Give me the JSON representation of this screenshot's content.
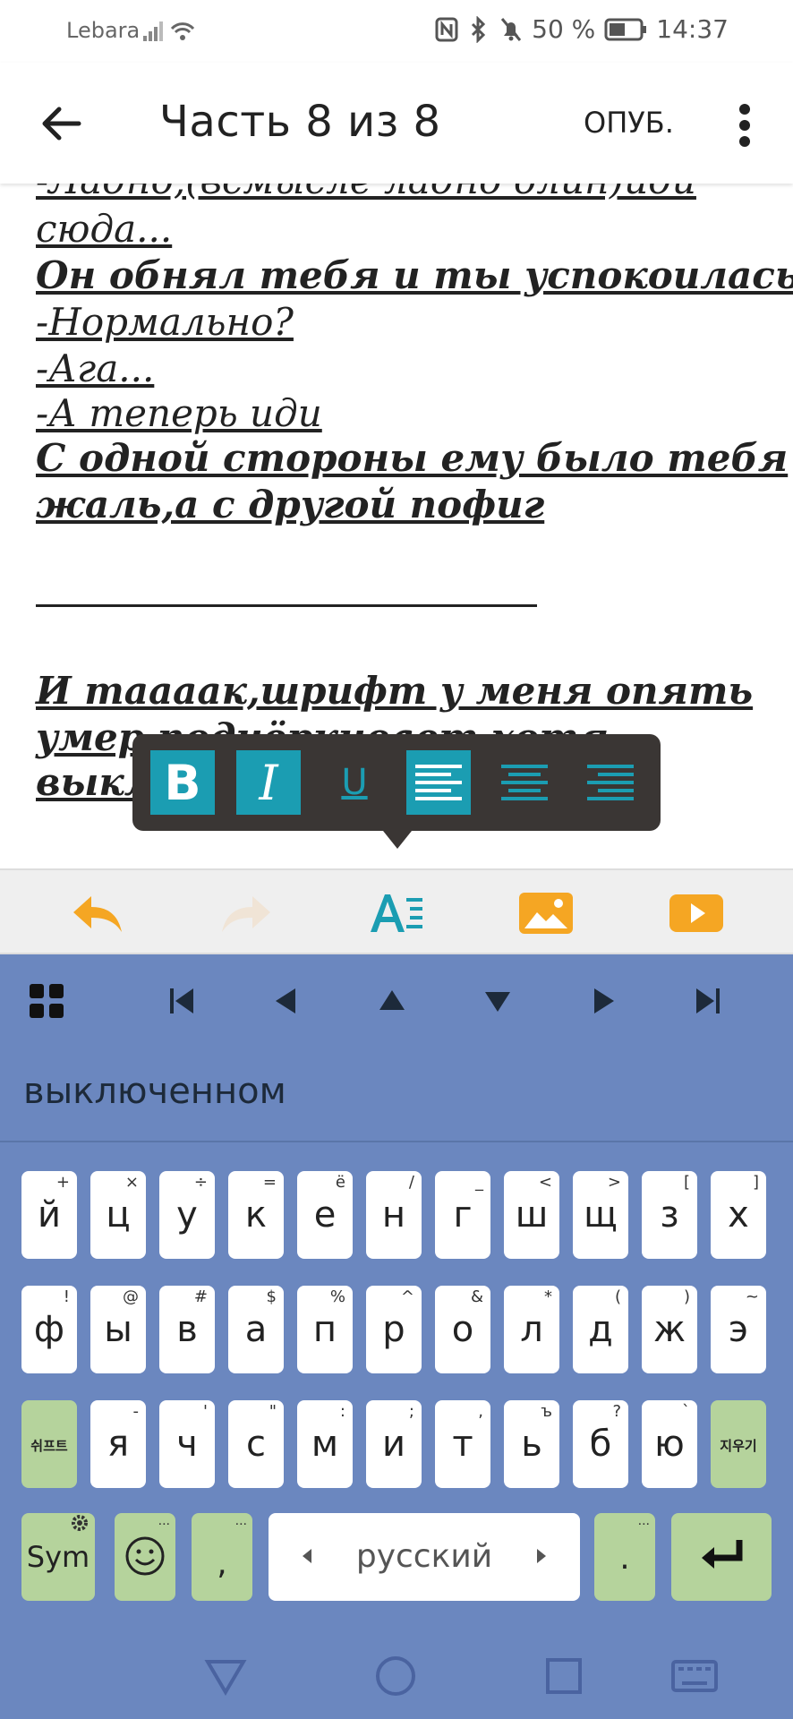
{
  "status_bar": {
    "carrier": "Lebara",
    "battery": "50 %",
    "time": "14:37"
  },
  "app_bar": {
    "title": "Часть 8 из 8",
    "publish_label": "ОПУБ."
  },
  "editor": {
    "lines": [
      "-Ладно,(всмысле ладно блин)иди",
      "сюда...",
      "Он обнял тебя и ты успокоилась",
      "-Нормально?",
      "-Ага...",
      "-А теперь иди",
      "С одной стороны ему было тебя",
      "жаль,а с другой пофиг",
      "И таааак,шрифт у меня опять",
      "умер подчёркивает хотя",
      "выкл"
    ]
  },
  "format_toolbar": {
    "bold": "B",
    "italic": "I",
    "underline": "U"
  },
  "keyboard": {
    "suggestion": "выключенном",
    "row1": [
      {
        "main": "й",
        "sec": "+"
      },
      {
        "main": "ц",
        "sec": "×"
      },
      {
        "main": "у",
        "sec": "÷"
      },
      {
        "main": "к",
        "sec": "="
      },
      {
        "main": "е",
        "sec": "ё"
      },
      {
        "main": "н",
        "sec": "/"
      },
      {
        "main": "г",
        "sec": "_"
      },
      {
        "main": "ш",
        "sec": "<"
      },
      {
        "main": "щ",
        "sec": ">"
      },
      {
        "main": "з",
        "sec": "["
      },
      {
        "main": "х",
        "sec": "]"
      }
    ],
    "row2": [
      {
        "main": "ф",
        "sec": "!"
      },
      {
        "main": "ы",
        "sec": "@"
      },
      {
        "main": "в",
        "sec": "#"
      },
      {
        "main": "а",
        "sec": "$"
      },
      {
        "main": "п",
        "sec": "%"
      },
      {
        "main": "р",
        "sec": "^"
      },
      {
        "main": "о",
        "sec": "&"
      },
      {
        "main": "л",
        "sec": "*"
      },
      {
        "main": "д",
        "sec": "("
      },
      {
        "main": "ж",
        "sec": ")"
      },
      {
        "main": "э",
        "sec": "~"
      }
    ],
    "row3": [
      {
        "main": "я",
        "sec": "-"
      },
      {
        "main": "ч",
        "sec": "'"
      },
      {
        "main": "с",
        "sec": "\""
      },
      {
        "main": "м",
        "sec": ":"
      },
      {
        "main": "и",
        "sec": ";"
      },
      {
        "main": "т",
        "sec": ","
      },
      {
        "main": "ь",
        "sec": "ъ"
      },
      {
        "main": "б",
        "sec": "?"
      },
      {
        "main": "ю",
        "sec": "`"
      }
    ],
    "shift_label": "쉬프트",
    "delete_label": "지우기",
    "sym_label": "Sym",
    "comma_label": ",",
    "period_label": ".",
    "space_label": "русский",
    "more_dots": "..."
  }
}
